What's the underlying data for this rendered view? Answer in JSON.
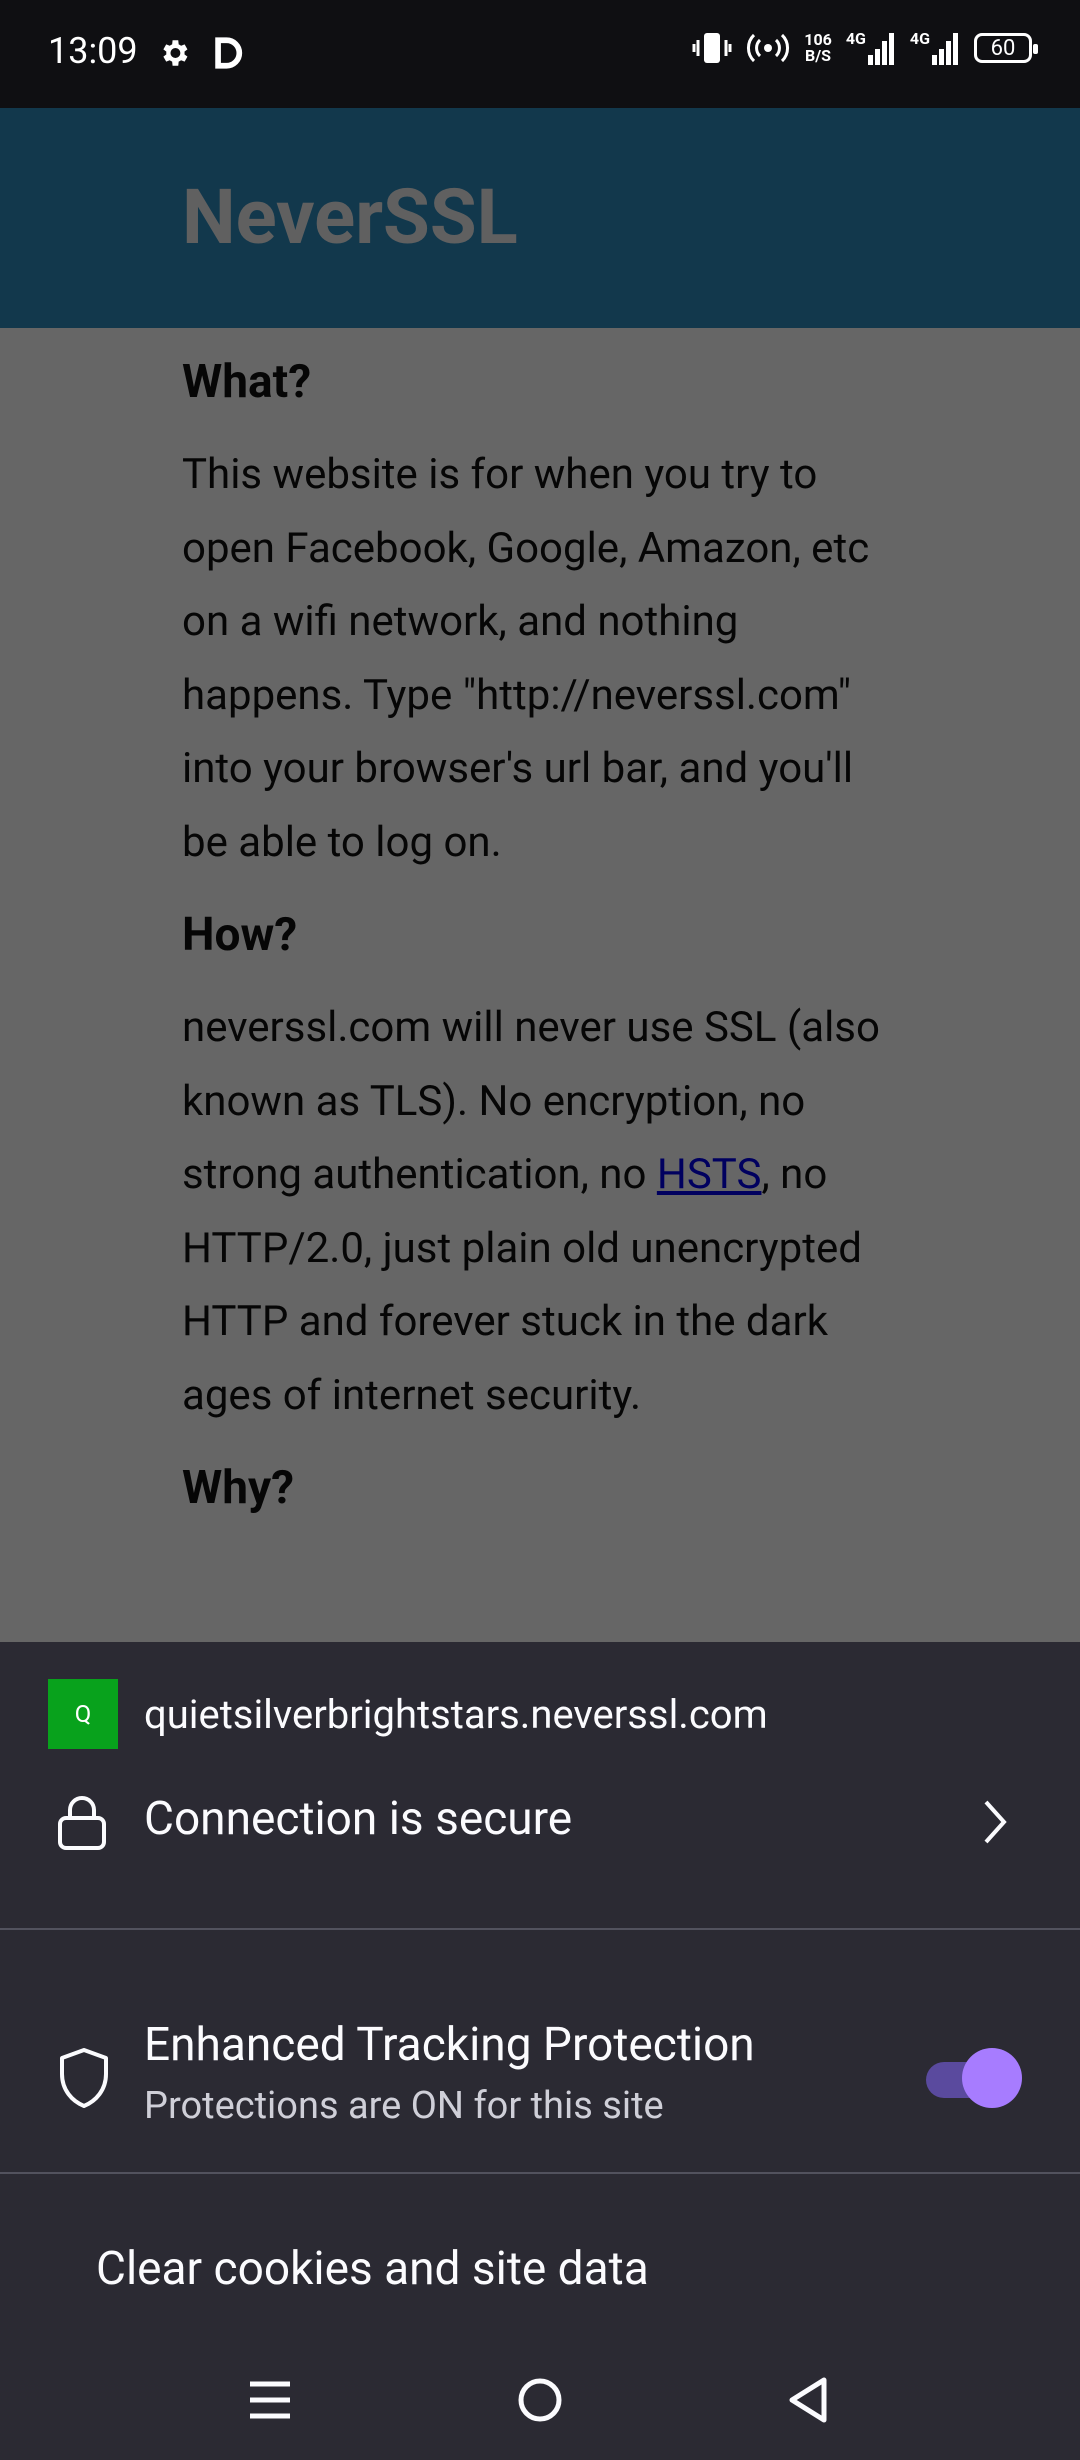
{
  "status_bar": {
    "time": "13:09",
    "left_icons": [
      "settings-gear-icon",
      "d-app-icon"
    ],
    "right_icons": [
      "vibrate-icon",
      "hotspot-icon",
      "4g-signal-icon",
      "4g-signal-icon"
    ],
    "speed_value": "106",
    "speed_unit": "B/S",
    "sim1_label": "4G",
    "sim2_label": "4G",
    "battery": "60"
  },
  "web_page": {
    "site_title": "NeverSSL",
    "sections": [
      {
        "heading": "What?",
        "body": "This website is for when you try to open Facebook, Google, Amazon, etc on a wifi network, and nothing happens. Type \"http://neverssl.com\" into your browser's url bar, and you'll be able to log on."
      },
      {
        "heading": "How?",
        "body_before_link": "neverssl.com will never use SSL (also known as TLS). No encryption, no strong authentication, no ",
        "link": "HSTS",
        "body_after_link": ", no HTTP/2.0, just plain old unencrypted HTTP and forever stuck in the dark ages of internet security."
      },
      {
        "heading": "Why?"
      }
    ]
  },
  "sheet": {
    "favicon_letter": "Q",
    "url": "quietsilverbrightstars.neverssl.com",
    "connection_label": "Connection is secure",
    "etp_title": "Enhanced Tracking Protection",
    "etp_subtitle": "Protections are ON for this site",
    "etp_enabled": true,
    "clear_label": "Clear cookies and site data",
    "accent_color": "#a77cff"
  },
  "nav_bar": {
    "buttons": [
      "menu-icon",
      "home-icon",
      "back-icon"
    ]
  }
}
